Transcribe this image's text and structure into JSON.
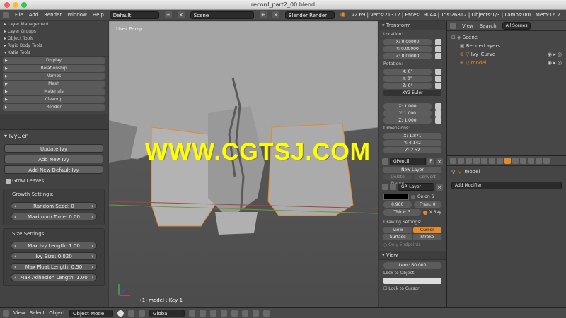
{
  "title": "record_part2_00.blend",
  "infobar": {
    "menus": [
      "File",
      "Add",
      "Render",
      "Window",
      "Help"
    ],
    "layout": "Default",
    "scene": "Scene",
    "engine": "Blender Render",
    "stats": "v2.69 | Verts:21312 | Faces:19044 | Tris:26812 | Objects:1/3 | Lamps:0/0 | Mem:16.2"
  },
  "toolshelf": {
    "tabs": [
      "Layer Management",
      "Layer Groups",
      "Object Tools",
      "Rigid Body Tools",
      "Katie Tools"
    ],
    "panels": [
      "Display",
      "Relationship",
      "Names",
      "Mesh",
      "Materials",
      "Cleanup",
      "Render"
    ],
    "ivygen": {
      "title": "IvyGen",
      "update": "Update Ivy",
      "add_new": "Add New Ivy",
      "add_default": "Add New Default Ivy",
      "grow_leaves": "Grow Leaves",
      "growth_title": "Growth Settings:",
      "random_seed": "Random Seed: 0",
      "max_time": "Maximum Time: 0.00",
      "size_title": "Size Settings:",
      "max_length": "Max Ivy Length: 1.00",
      "ivy_size": "Ivy Size: 0.020",
      "max_float": "Max Float Length: 0.50",
      "max_adhesion": "Max Adhesion Length: 1.00"
    }
  },
  "viewport": {
    "label": "User Persp",
    "object_info": "(1) model : Key 1",
    "watermark": "WWW.CGTSJ.COM"
  },
  "npanel": {
    "transform": "Transform",
    "location": "Location:",
    "loc": [
      "X: 0.00000",
      "Y: 0.00000",
      "Z: 0.00000"
    ],
    "rotation": "Rotation:",
    "rot": [
      "X: 0°",
      "Y: 0°",
      "Z: 0°"
    ],
    "rot_mode": "XYZ Euler",
    "scale": [
      "X: 1.000",
      "Y: 1.000",
      "Z: 1.000"
    ],
    "dimensions": "Dimensions:",
    "dims": [
      "X: 1.871",
      "Y: 4.142",
      "Z: 2.52"
    ],
    "gpencil": "GPencil",
    "new_layer": "New Layer",
    "delete_frame": "Delete Frame",
    "convert": "Convert",
    "layer": "GP_Layer",
    "onion": "Onion S",
    "opacity": "0.900",
    "frame": "Fram: 0",
    "thick": "Thick: 3",
    "xray": "X Ray",
    "drawing_settings": "Drawing Settings:",
    "view_btn": "View",
    "cursor_btn": "Cursor",
    "surface_btn": "Surface",
    "stroke_btn": "Stroke",
    "only_endpoints": "Only Endpoints",
    "view_title": "View",
    "lens": "Lens: 60.000",
    "lock_object": "Lock to Object:",
    "lock_cursor": "Lock to Cursor"
  },
  "outliner": {
    "view": "View",
    "search": "Search",
    "all_scenes": "All Scenes",
    "items": [
      "Scene",
      "RenderLayers",
      "Ivy_Curve",
      "model"
    ]
  },
  "properties": {
    "object": "model",
    "add_modifier": "Add Modifier"
  },
  "bottombar": {
    "menus": [
      "View",
      "Select",
      "Object"
    ],
    "mode": "Object Mode",
    "orientation": "Global"
  },
  "colors": {
    "accent": "#e58a2a",
    "watermark": "#ffff00"
  }
}
